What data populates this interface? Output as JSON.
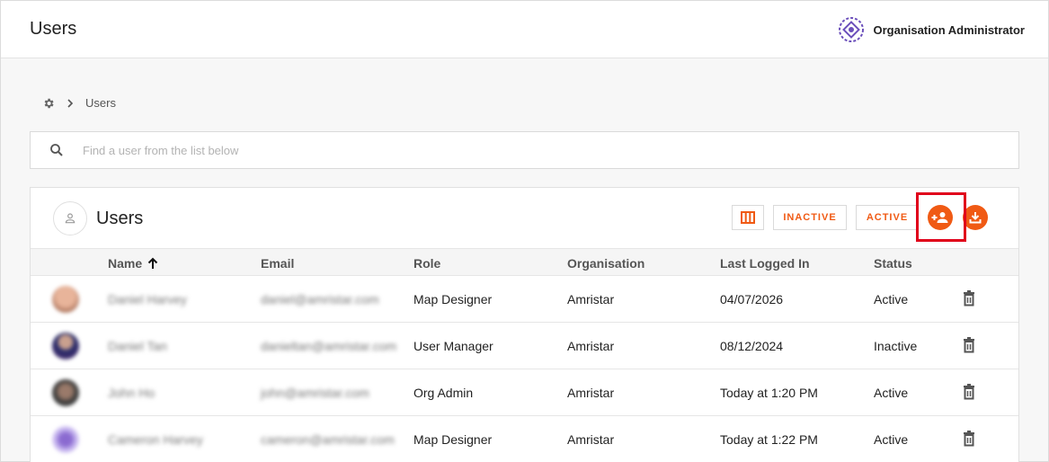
{
  "header": {
    "title": "Users",
    "org_name": "Organisation Administrator",
    "org_logo_icon": "org-logo-icon"
  },
  "breadcrumb": {
    "home_icon": "gear-icon",
    "separator_icon": "chevron-right-icon",
    "current": "Users"
  },
  "search": {
    "placeholder": "Find a user from the list below",
    "value": ""
  },
  "card": {
    "title": "Users",
    "buttons": {
      "columns_icon": "columns-icon",
      "inactive_label": "INACTIVE",
      "active_label": "ACTIVE",
      "add_user_icon": "add-user-icon",
      "download_icon": "download-icon"
    }
  },
  "table": {
    "columns": [
      "Name",
      "Email",
      "Role",
      "Organisation",
      "Last Logged In",
      "Status"
    ],
    "sort_column": "Name",
    "sort_direction": "ascending",
    "rows": [
      {
        "name": "Daniel Harvey",
        "email": "daniel@amristar.com",
        "role": "Map Designer",
        "organisation": "Amristar",
        "last_logged_in": "04/07/2026",
        "status": "Active"
      },
      {
        "name": "Daniel Tan",
        "email": "danieltan@amristar.com",
        "role": "User Manager",
        "organisation": "Amristar",
        "last_logged_in": "08/12/2024",
        "status": "Inactive"
      },
      {
        "name": "John Ho",
        "email": "john@amristar.com",
        "role": "Org Admin",
        "organisation": "Amristar",
        "last_logged_in": "Today at 1:20 PM",
        "status": "Active"
      },
      {
        "name": "Cameron Harvey",
        "email": "cameron@amristar.com",
        "role": "Map Designer",
        "organisation": "Amristar",
        "last_logged_in": "Today at 1:22 PM",
        "status": "Active"
      }
    ]
  },
  "colors": {
    "accent": "#f05a14",
    "highlight": "#e0001b",
    "logo": "#6b4fbb"
  }
}
